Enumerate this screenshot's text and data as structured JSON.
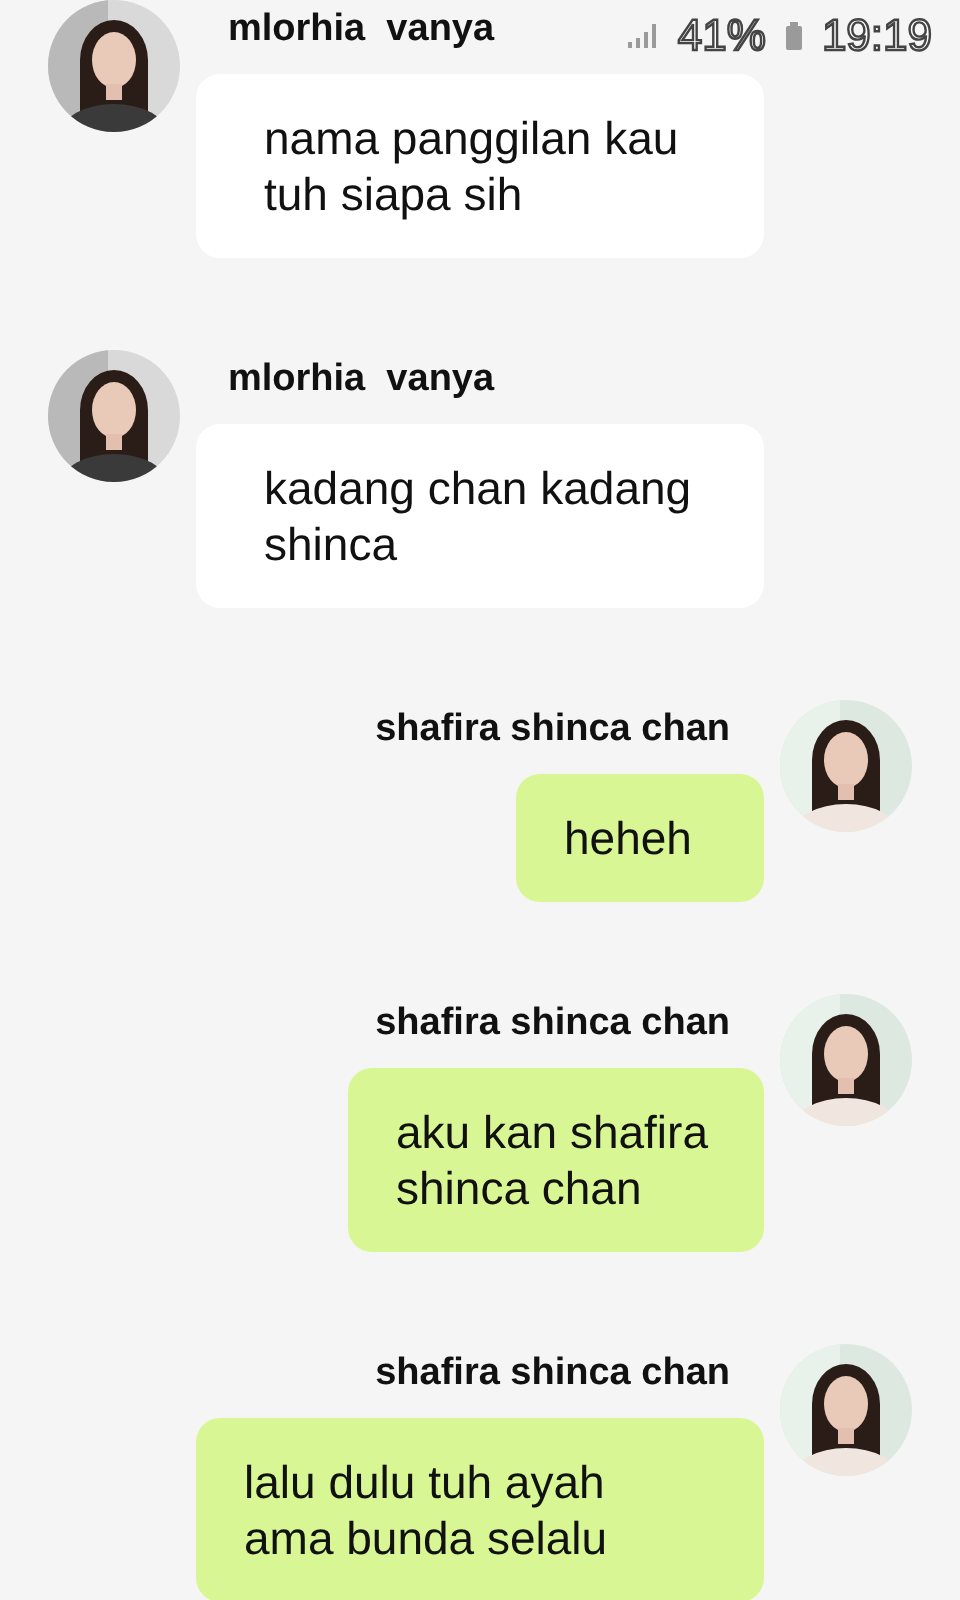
{
  "status_bar": {
    "battery": "41%",
    "time": "19:19"
  },
  "messages": [
    {
      "kind": "incoming",
      "sender": "mlorhia  vanya",
      "text": "nama panggilan kau\ntuh siapa sih"
    },
    {
      "kind": "incoming",
      "sender": "mlorhia  vanya",
      "text": "kadang chan kadang\nshinca"
    },
    {
      "kind": "outgoing",
      "sender": "shafira shinca chan",
      "text": "heheh"
    },
    {
      "kind": "outgoing",
      "sender": "shafira shinca chan",
      "text": "aku kan shafira\nshinca chan"
    },
    {
      "kind": "outgoing",
      "sender": "shafira shinca chan",
      "text": "lalu dulu tuh ayah\nama bunda selalu"
    }
  ]
}
